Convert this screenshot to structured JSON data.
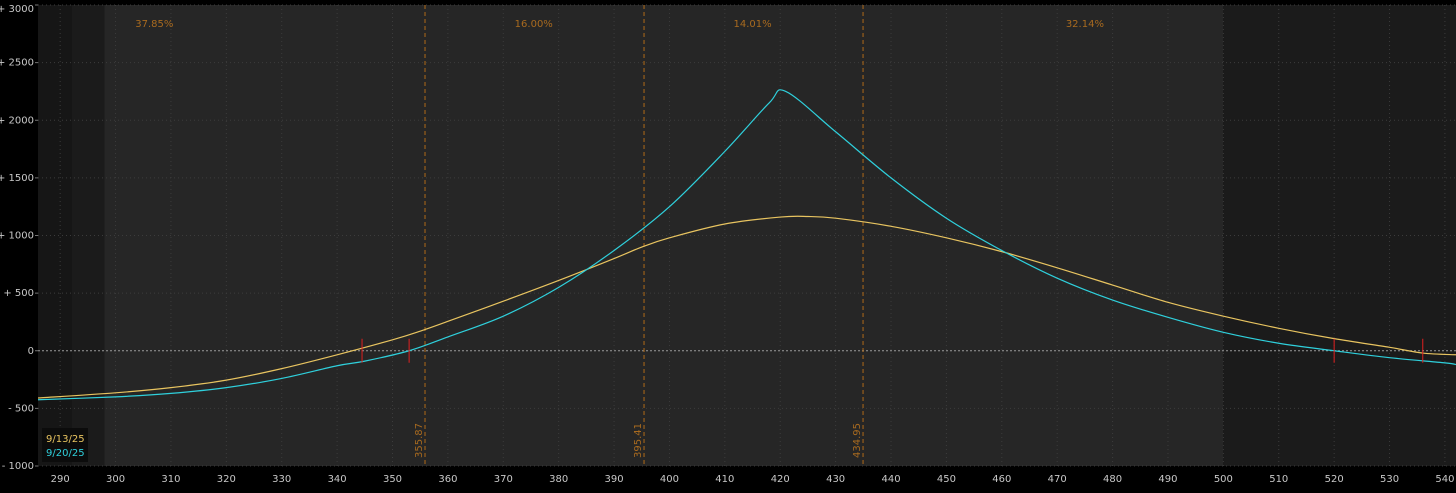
{
  "chart_data": {
    "type": "line",
    "xlim": [
      286,
      542
    ],
    "ylim": [
      -1000,
      3000
    ],
    "x_ticks": [
      290,
      300,
      310,
      320,
      330,
      340,
      350,
      360,
      370,
      380,
      390,
      400,
      410,
      420,
      430,
      440,
      450,
      460,
      470,
      480,
      490,
      500,
      510,
      520,
      530,
      540
    ],
    "y_ticks": [
      -1000,
      -500,
      0,
      500,
      1000,
      1500,
      2000,
      2500,
      3000
    ],
    "y_tick_labels": [
      "- 1000",
      "- 500",
      "0",
      "+ 500",
      "+ 1000",
      "+ 1500",
      "+ 2000",
      "+ 2500",
      "+ 3000"
    ],
    "grid": true,
    "shaded_ranges": [
      {
        "from": 286,
        "to": 292,
        "shade": "darkest"
      },
      {
        "from": 292,
        "to": 298,
        "shade": "dark"
      },
      {
        "from": 298,
        "to": 500,
        "shade": "light"
      },
      {
        "from": 500,
        "to": 542,
        "shade": "dark"
      }
    ],
    "vertical_markers": [
      {
        "x": 355.87,
        "label": "355.87"
      },
      {
        "x": 395.41,
        "label": "395.41"
      },
      {
        "x": 434.95,
        "label": "434.95"
      }
    ],
    "range_percentages": [
      {
        "label": "37.85%",
        "x": 307
      },
      {
        "label": "16.00%",
        "x": 375.5
      },
      {
        "label": "14.01%",
        "x": 415
      },
      {
        "label": "32.14%",
        "x": 475
      }
    ],
    "breakeven_marks": [
      344.5,
      353,
      520,
      536
    ],
    "series": [
      {
        "name": "9/13/25",
        "color": "#e8c460",
        "x": [
          286,
          300,
          310,
          320,
          330,
          340,
          350,
          355,
          360,
          370,
          380,
          390,
          395,
          400,
          410,
          420,
          425,
          430,
          440,
          450,
          460,
          470,
          480,
          490,
          500,
          510,
          520,
          530,
          536,
          542
        ],
        "y": [
          -410,
          -365,
          -320,
          -255,
          -155,
          -35,
          95,
          170,
          255,
          430,
          610,
          800,
          900,
          980,
          1100,
          1160,
          1165,
          1150,
          1080,
          980,
          860,
          720,
          570,
          420,
          300,
          195,
          105,
          30,
          -20,
          -35
        ]
      },
      {
        "name": "9/20/25",
        "color": "#2fd0dc",
        "x": [
          286,
          300,
          310,
          320,
          330,
          340,
          345,
          353,
          360,
          370,
          380,
          390,
          400,
          410,
          418,
          421,
          430,
          440,
          450,
          460,
          470,
          480,
          490,
          500,
          510,
          520,
          530,
          540,
          542
        ],
        "y": [
          -425,
          -400,
          -370,
          -320,
          -240,
          -130,
          -90,
          0,
          120,
          300,
          550,
          870,
          1250,
          1730,
          2150,
          2250,
          1900,
          1500,
          1150,
          870,
          630,
          440,
          290,
          160,
          65,
          0,
          -60,
          -105,
          -120
        ]
      }
    ]
  }
}
